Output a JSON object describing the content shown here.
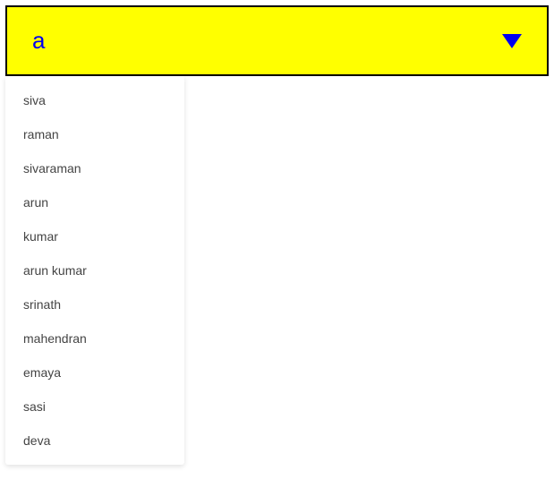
{
  "dropdown": {
    "value": "a",
    "options": [
      "siva",
      "raman",
      "sivaraman",
      "arun",
      "kumar",
      "arun kumar",
      "srinath",
      "mahendran",
      "emaya",
      "sasi",
      "deva"
    ]
  }
}
